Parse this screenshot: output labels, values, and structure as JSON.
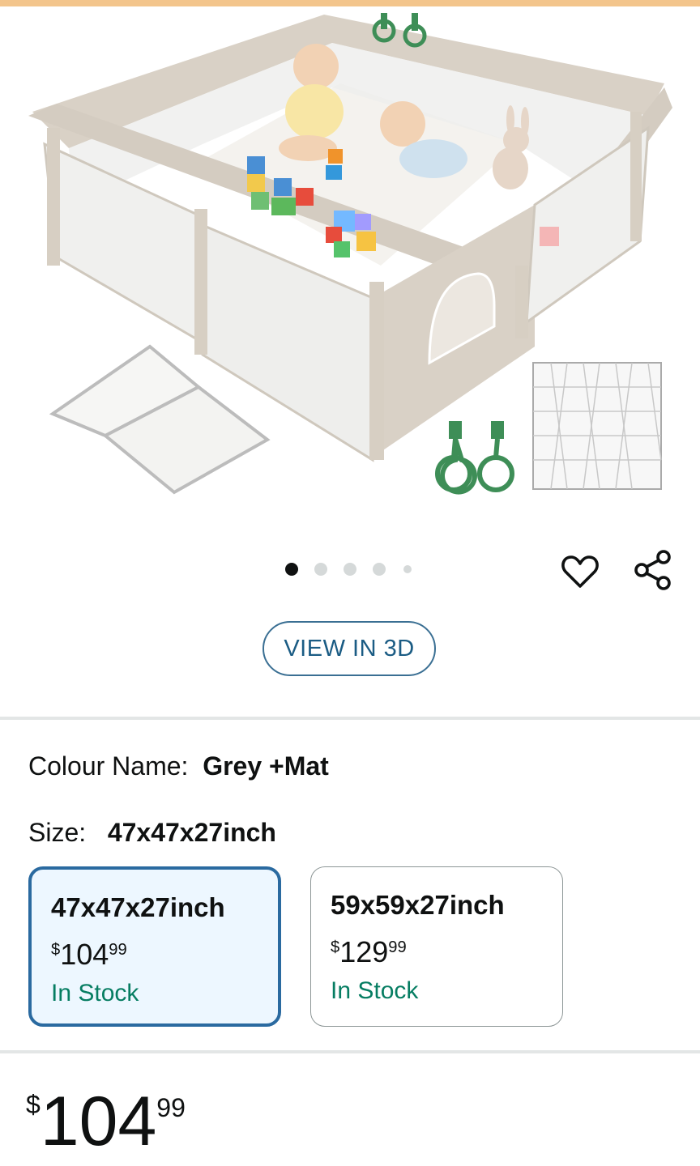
{
  "product_image": {
    "description_icon": "playpen-product-photo",
    "carousel": {
      "total": 5,
      "active_index": 0
    }
  },
  "actions": {
    "wishlist_icon": "heart-icon",
    "share_icon": "share-icon",
    "view_3d_label": "VIEW IN 3D"
  },
  "colour": {
    "label": "Colour Name:",
    "value": "Grey +Mat"
  },
  "size": {
    "label": "Size:",
    "value": "47x47x27inch",
    "options": [
      {
        "name": "47x47x27inch",
        "currency": "$",
        "whole": "104",
        "fraction": "99",
        "stock": "In Stock",
        "selected": true
      },
      {
        "name": "59x59x27inch",
        "currency": "$",
        "whole": "129",
        "fraction": "99",
        "stock": "In Stock",
        "selected": false
      }
    ]
  },
  "price": {
    "currency": "$",
    "whole": "104",
    "fraction": "99"
  },
  "colors": {
    "accent_blue": "#2a6aa0",
    "stock_green": "#067d62",
    "top_bar": "#f3c58c"
  }
}
